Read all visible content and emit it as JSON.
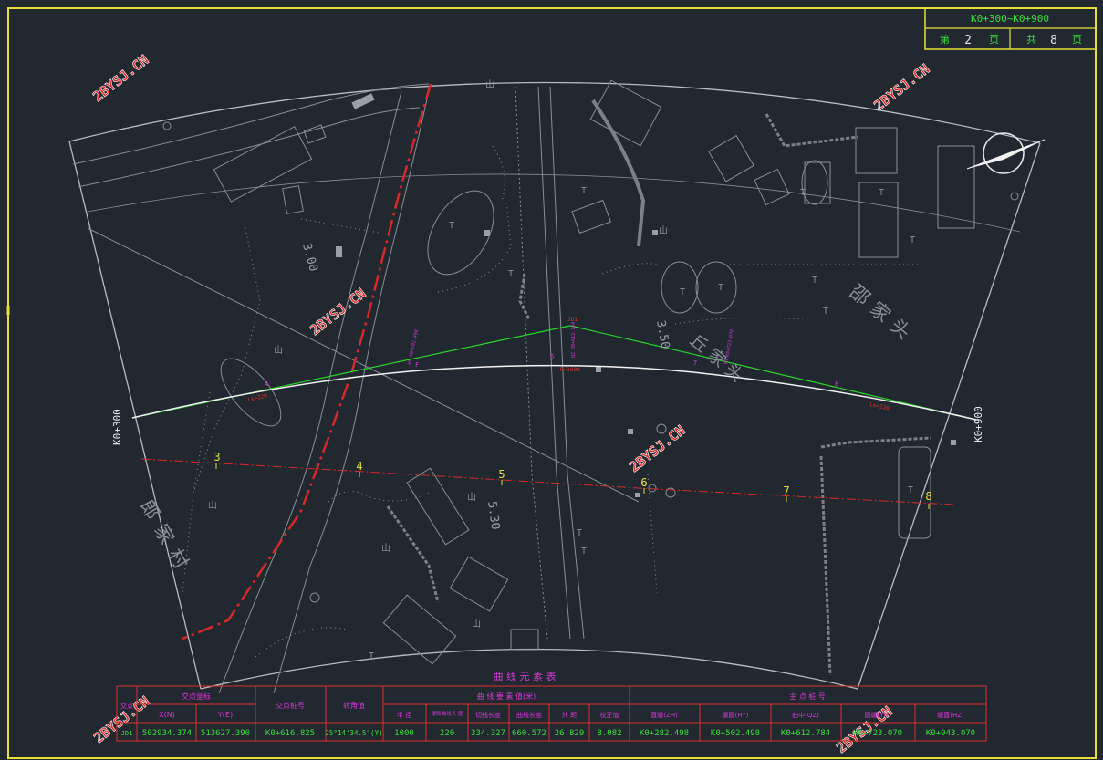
{
  "sheet": {
    "station_range": "K0+300~K0+900",
    "page_label_prefix": "第",
    "page_number": "2",
    "page_unit": "页",
    "total_label_prefix": "共",
    "total_pages": "8",
    "total_unit": "页"
  },
  "watermark": "2BYSJ.CN",
  "map": {
    "start_station": "K0+300",
    "end_station": "K0+900",
    "contour_labels": [
      "3.00",
      "3.50",
      "5.30"
    ],
    "village_labels": [
      "郎家村",
      "邵家头",
      "丘家头"
    ],
    "station_ticks": [
      "3",
      "4",
      "5",
      "6",
      "7",
      "8"
    ],
    "curve_labels": {
      "ls_left": "Ls=220",
      "ls_right": "Ls=220",
      "radius": "R=1000",
      "jd": "JD1"
    },
    "mag_labels": [
      "4",
      "6",
      "7",
      "8",
      "F"
    ],
    "rotated_station_labels": [
      "HY K0+502.498",
      "QZ K0+612.784",
      "YH K0+723.070"
    ]
  },
  "table": {
    "title": "曲 线 元 素 表",
    "main_points_title": "主 点 桩 号",
    "curve_elements_title": "曲 线 要 素 值(米)",
    "headers": {
      "jd": "交点",
      "coords": "交点坐标",
      "x": "X(N)",
      "y": "Y(E)",
      "jd_station": "交点桩号",
      "angle": "转角值",
      "radius": "半 径",
      "ls": "缓和曲线长 度",
      "tangent": "切线长度",
      "curve_len": "曲线长度",
      "external": "外 距",
      "correction": "校正值",
      "zh": "直缓(ZH)",
      "hy": "缓圆(HY)",
      "qz": "曲中(QZ)",
      "yh": "圆缓(YH)",
      "hz": "缓直(HZ)"
    },
    "row": {
      "jd": "JD1",
      "x": "502934.374",
      "y": "513627.390",
      "jd_station": "K0+616.825",
      "angle": "25°14'34.5\"(Y)",
      "radius": "1000",
      "ls": "220",
      "tangent": "334.327",
      "curve_len": "660.572",
      "external": "26.829",
      "correction": "8.082",
      "zh": "K0+282.498",
      "hy": "K0+502.498",
      "qz": "K0+612.784",
      "yh": "K0+723.070",
      "hz": "K0+943.070"
    }
  },
  "colors": {
    "background": "#212830",
    "frame": "#e8e034",
    "table_line": "#e0312c",
    "table_header": "#d838d8",
    "table_value": "#37e037",
    "tangent_line": "#2ad62a",
    "centerline": "#f2f2f2",
    "survey_line": "#d82828",
    "terrain": "#8a8f96",
    "watermark": "#e02828"
  }
}
